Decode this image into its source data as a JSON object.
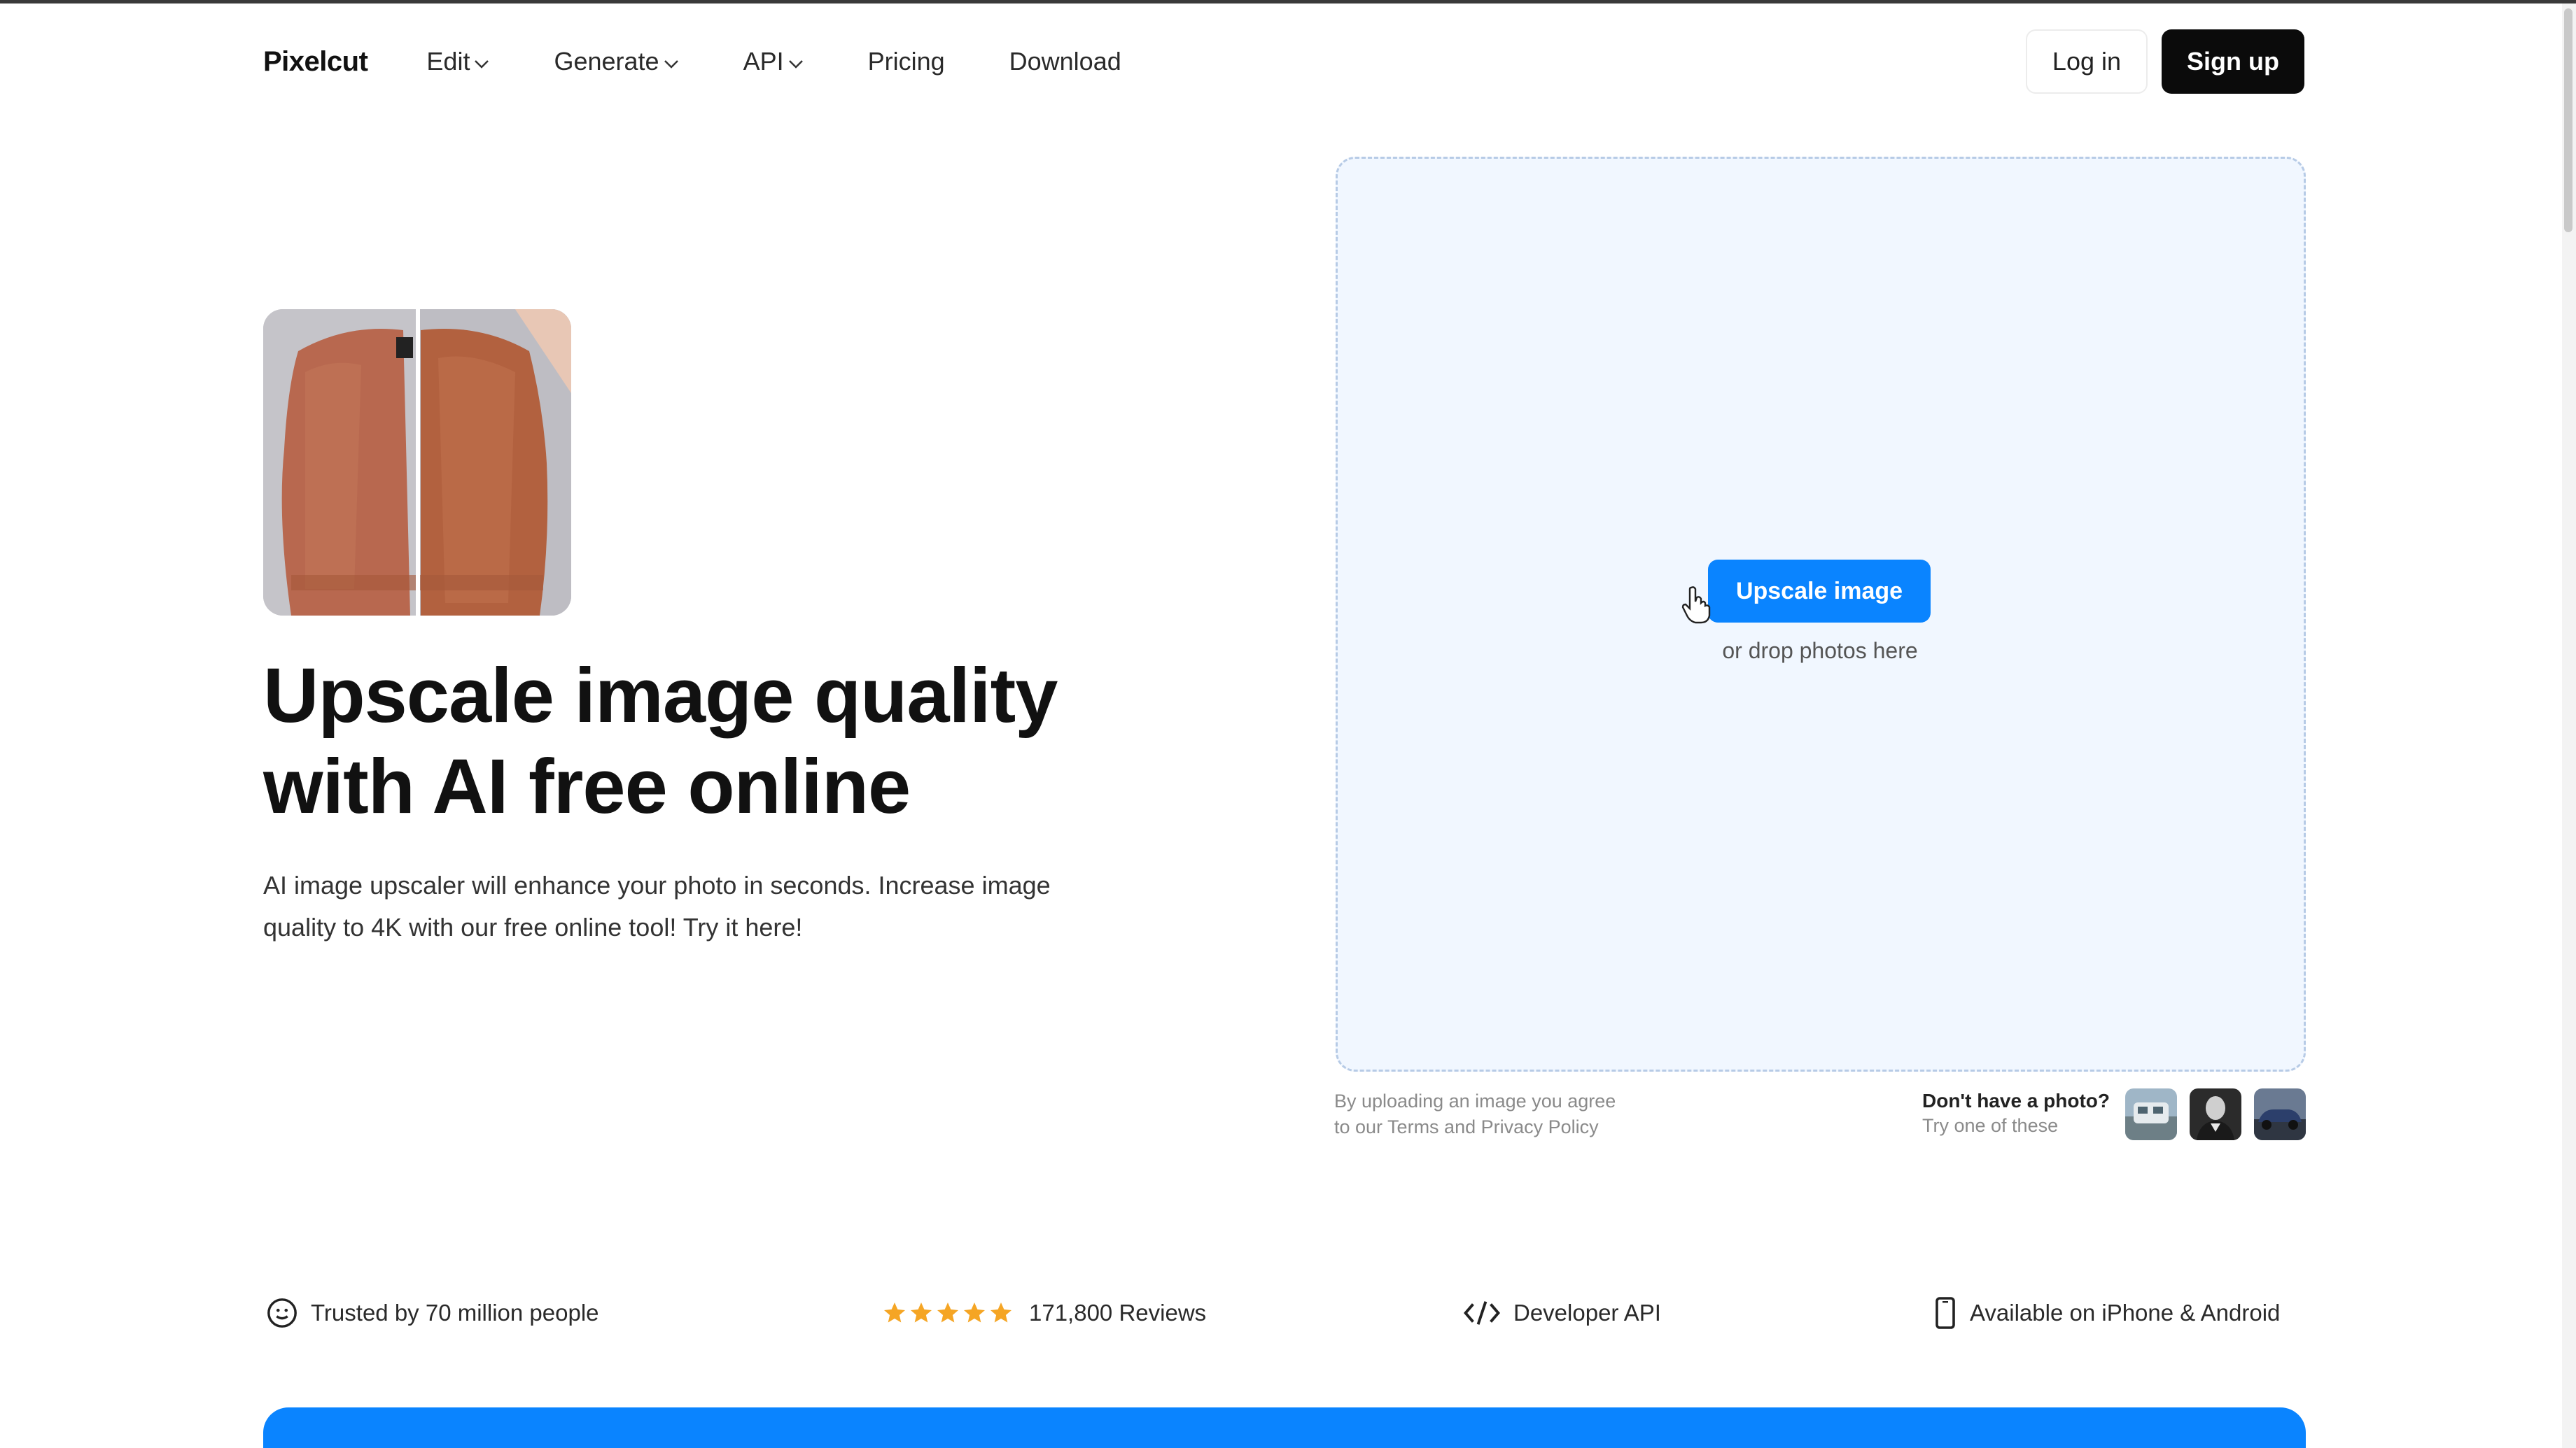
{
  "nav": {
    "logo": "Pixelcut",
    "items": [
      {
        "label": "Edit",
        "dropdown": true
      },
      {
        "label": "Generate",
        "dropdown": true
      },
      {
        "label": "API",
        "dropdown": true
      },
      {
        "label": "Pricing",
        "dropdown": false
      },
      {
        "label": "Download",
        "dropdown": false
      }
    ],
    "login_label": "Log in",
    "signup_label": "Sign up"
  },
  "hero": {
    "headline_line1": "Upscale image quality",
    "headline_line2": "with AI free online",
    "subtext_line1": "AI image upscaler will enhance your photo in seconds. Increase image",
    "subtext_line2": "quality to 4K with our free online tool! Try it here!"
  },
  "upload": {
    "button_label": "Upscale image",
    "drop_hint": "or drop photos here",
    "terms_line1": "By uploading an image you agree",
    "terms_line2": "to our Terms and Privacy Policy",
    "sample_question": "Don't have a photo?",
    "sample_subtext": "Try one of these"
  },
  "trust": {
    "people": "Trusted by 70 million people",
    "rating_stars": 5,
    "reviews": "171,800 Reviews",
    "api": "Developer API",
    "platforms": "Available on iPhone & Android"
  },
  "colors": {
    "accent": "#0a84ff",
    "signup_bg": "#0b0b0b",
    "drop_zone_bg": "#f1f7ff",
    "star": "#f5a524"
  },
  "icons": {
    "chevron": "chevron-down-icon",
    "smile": "smile-icon",
    "star": "star-icon",
    "code": "code-icon",
    "phone": "phone-icon",
    "cursor": "hand-cursor-icon"
  }
}
